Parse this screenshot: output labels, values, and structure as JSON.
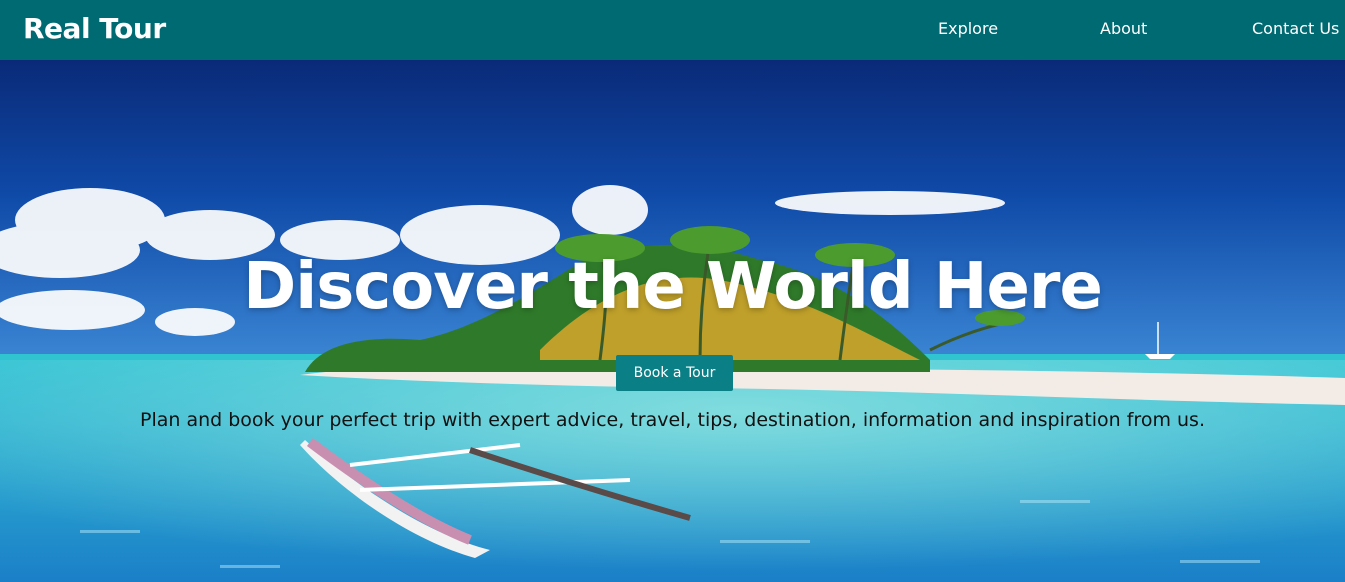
{
  "brand": {
    "name": "Real Tour"
  },
  "nav": {
    "items": [
      {
        "label": "Explore"
      },
      {
        "label": "About"
      },
      {
        "label": "Contact Us"
      }
    ]
  },
  "hero": {
    "headline": "Discover the World Here",
    "cta_label": "Book a Tour",
    "tagline": "Plan and book your perfect trip with expert advice, travel, tips, destination, information and inspiration from us.",
    "image": "tropical-island-lagoon-boat"
  },
  "colors": {
    "navbar": "#006a72",
    "button": "#0b7f86"
  }
}
